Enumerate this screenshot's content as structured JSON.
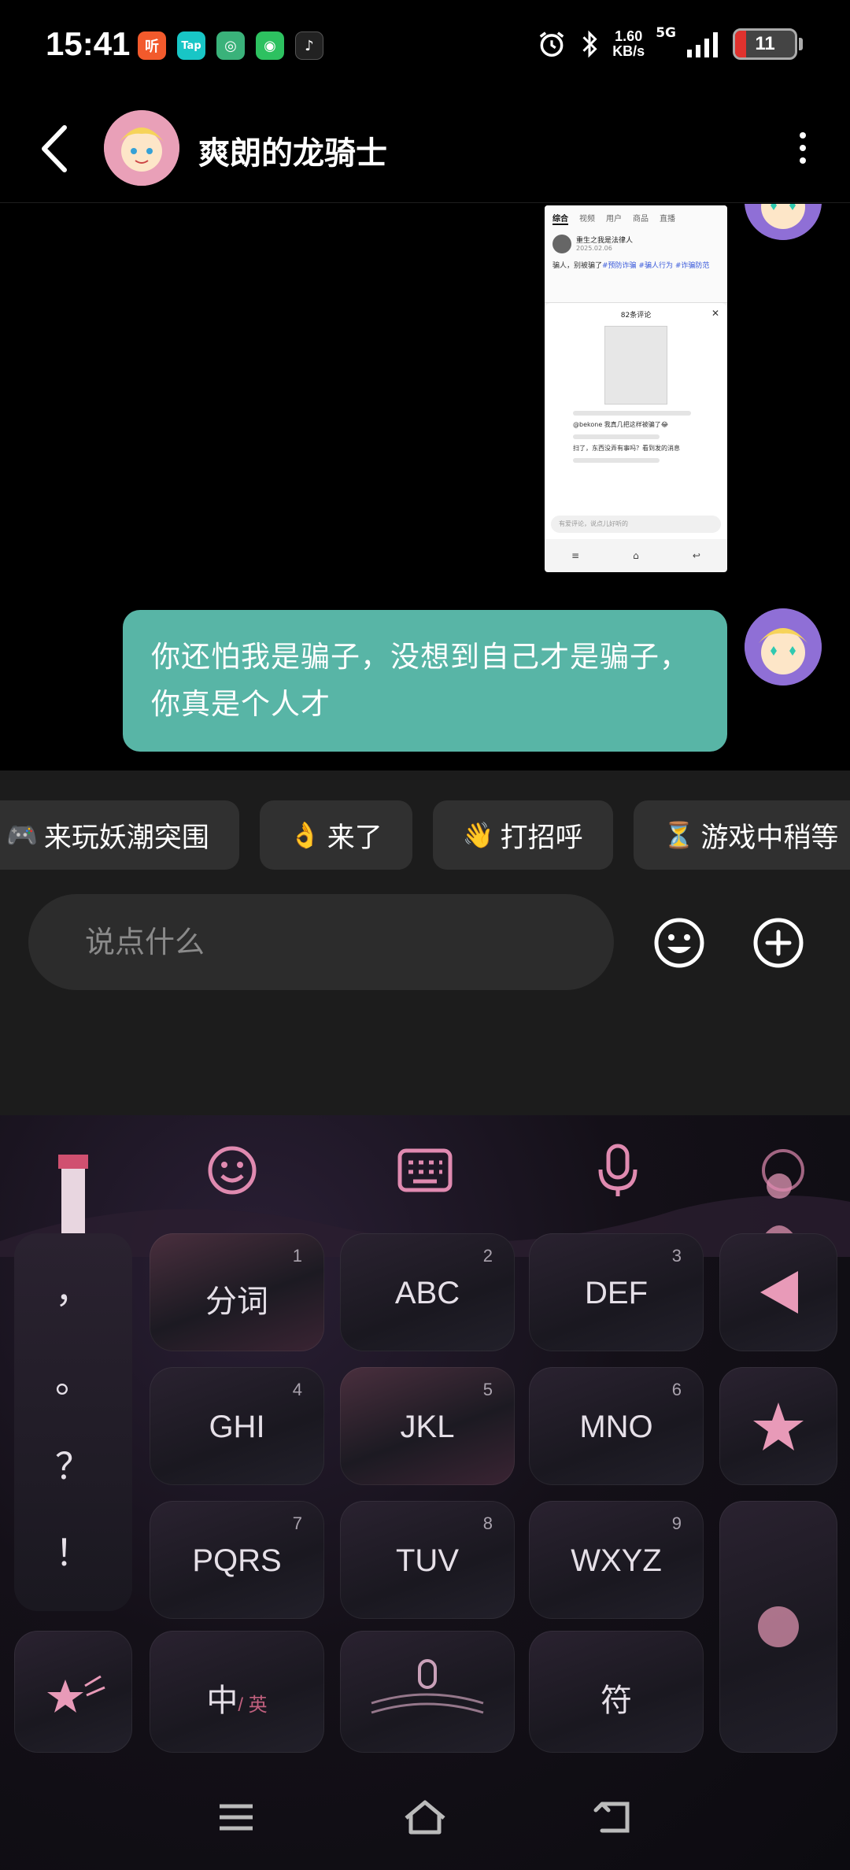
{
  "status_bar": {
    "time": "15:41",
    "notifications": [
      {
        "icon": "listen-app-icon",
        "glyph": "听",
        "color": "#f25a2c"
      },
      {
        "icon": "taptap-icon",
        "glyph": "Tap",
        "color": "#18c6c6"
      },
      {
        "icon": "green-app-icon",
        "glyph": "◎",
        "color": "#3ab27a"
      },
      {
        "icon": "wechat-icon",
        "glyph": "◉",
        "color": "#2dc160"
      },
      {
        "icon": "tiktok-icon",
        "glyph": "♪",
        "color": "#222222"
      }
    ],
    "net_speed_value": "1.60",
    "net_speed_unit": "KB/s",
    "network": "5G",
    "battery": "11"
  },
  "header": {
    "title": "爽朗的龙骑士"
  },
  "chat": {
    "screenshot_preview": {
      "tabs": [
        "综合",
        "视频",
        "用户",
        "商品",
        "直播"
      ],
      "post_author": "重生之我是法律人",
      "post_date": "2025.02.06",
      "post_text": "骗人，别被骗了",
      "post_tags": "#预防诈骗 #骗人行为 #诈骗防范",
      "comments_title": "82条评论",
      "comment_a": "@bekone 我真几把这样被骗了😂",
      "comment_b": "扫了，东西没弄有事吗？看到发的消息",
      "input_placeholder": "有爱评论，说点儿好听的"
    },
    "bubble_text": "你还怕我是骗子，没想到自己才是骗子，你真是个人才"
  },
  "quick_replies": [
    {
      "emoji": "🎮",
      "label": "来玩妖潮突围"
    },
    {
      "emoji": "👌",
      "label": "来了"
    },
    {
      "emoji": "👋",
      "label": "打招呼"
    },
    {
      "emoji": "⏳",
      "label": "游戏中稍等"
    }
  ],
  "composer": {
    "placeholder": "说点什么"
  },
  "keyboard": {
    "punctuation": [
      "，",
      "。",
      "？",
      "！"
    ],
    "keys": [
      {
        "label": "分词",
        "num": "1"
      },
      {
        "label": "ABC",
        "num": "2"
      },
      {
        "label": "DEF",
        "num": "3"
      },
      {
        "label": "GHI",
        "num": "4"
      },
      {
        "label": "JKL",
        "num": "5"
      },
      {
        "label": "MNO",
        "num": "6"
      },
      {
        "label": "PQRS",
        "num": "7"
      },
      {
        "label": "TUV",
        "num": "8"
      },
      {
        "label": "WXYZ",
        "num": "9"
      }
    ],
    "lang_main": "中",
    "lang_sub": "/ 英",
    "symbol_key": "符"
  },
  "colors": {
    "bubble": "#58b5a6",
    "accent_pink": "#e08ab0"
  }
}
